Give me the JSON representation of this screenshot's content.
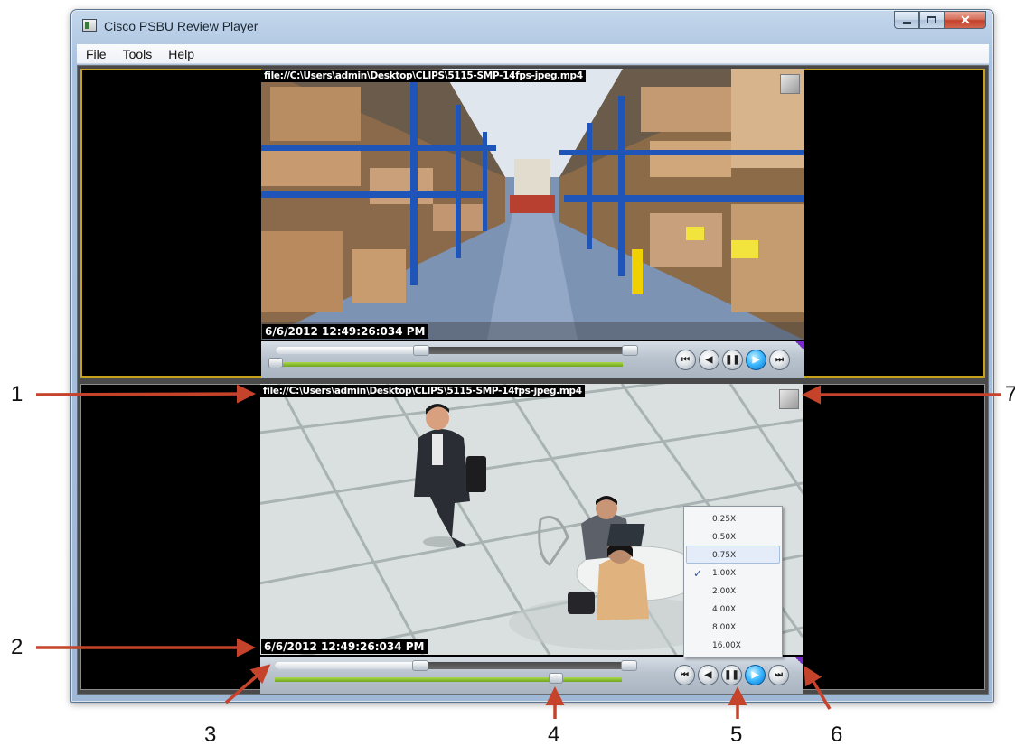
{
  "window": {
    "title": "Cisco PSBU Review Player"
  },
  "menu": {
    "file": "File",
    "tools": "Tools",
    "help": "Help"
  },
  "player_top": {
    "filepath": "file://C:\\Users\\admin\\Desktop\\CLIPS\\5115-SMP-14fps-jpeg.mp4",
    "timestamp": "6/6/2012 12:49:26:034 PM",
    "seek_fraction": 0.41,
    "play_fraction": 0.0
  },
  "player_bottom": {
    "filepath": "file://C:\\Users\\admin\\Desktop\\CLIPS\\5115-SMP-14fps-jpeg.mp4",
    "timestamp": "6/6/2012 12:49:26:034 PM",
    "seek_fraction": 0.41,
    "play_fraction": 0.81
  },
  "speed_menu": {
    "options": [
      "0.25X",
      "0.50X",
      "0.75X",
      "1.00X",
      "2.00X",
      "4.00X",
      "8.00X",
      "16.00X"
    ],
    "selected": "1.00X",
    "highlighted": "0.75X"
  },
  "controls": {
    "icons": [
      "skip-back-icon",
      "step-back-icon",
      "pause-icon",
      "play-icon",
      "skip-forward-icon"
    ]
  },
  "callouts": {
    "c1": "1",
    "c2": "2",
    "c3": "3",
    "c4": "4",
    "c5": "5",
    "c6": "6",
    "c7": "7"
  },
  "colors": {
    "selected_pane_border": "#c8a11a",
    "progress_green": "#8cc63f",
    "arrow_red": "#c6432b",
    "active_button_blue": "#1e90ff"
  }
}
